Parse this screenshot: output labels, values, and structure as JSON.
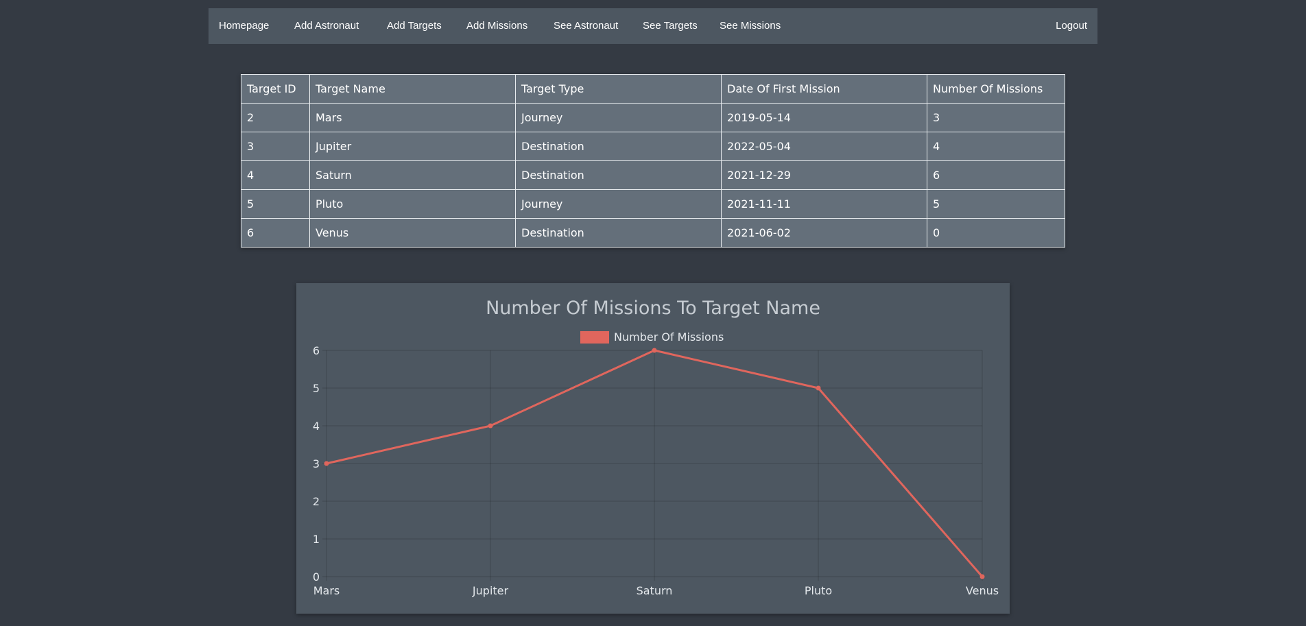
{
  "nav": {
    "items": [
      "Homepage",
      "Add Astronaut",
      "Add Targets",
      "Add Missions",
      "See Astronaut",
      "See Targets",
      "See Missions"
    ],
    "logout": "Logout"
  },
  "table": {
    "headers": [
      "Target ID",
      "Target Name",
      "Target Type",
      "Date Of First Mission",
      "Number Of Missions"
    ],
    "rows": [
      [
        "2",
        "Mars",
        "Journey",
        "2019-05-14",
        "3"
      ],
      [
        "3",
        "Jupiter",
        "Destination",
        "2022-05-04",
        "4"
      ],
      [
        "4",
        "Saturn",
        "Destination",
        "2021-12-29",
        "6"
      ],
      [
        "5",
        "Pluto",
        "Journey",
        "2021-11-11",
        "5"
      ],
      [
        "6",
        "Venus",
        "Destination",
        "2021-06-02",
        "0"
      ]
    ]
  },
  "chart_data": {
    "type": "line",
    "title": "Number Of Missions To Target Name",
    "categories": [
      "Mars",
      "Jupiter",
      "Saturn",
      "Pluto",
      "Venus"
    ],
    "series": [
      {
        "name": "Number Of Missions",
        "values": [
          3,
          4,
          6,
          5,
          0
        ],
        "color": "#e0665d"
      }
    ],
    "ylim": [
      0,
      6
    ],
    "yticks": [
      0,
      1,
      2,
      3,
      4,
      5,
      6
    ],
    "grid": true,
    "legend": "top-center"
  },
  "colors": {
    "background": "#343a43",
    "panel": "#4d5761",
    "table_bg": "#646f7a",
    "accent": "#e0665d"
  }
}
